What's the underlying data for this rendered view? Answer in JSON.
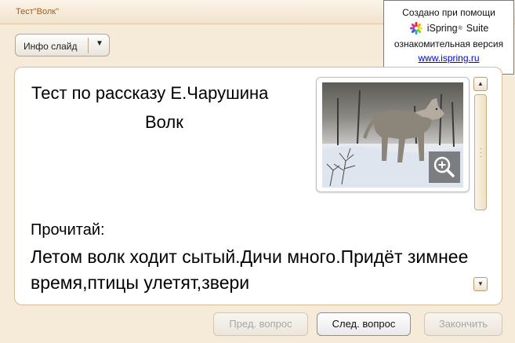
{
  "window": {
    "title": "Тест\"Волк\""
  },
  "watermark": {
    "line1": "Создано при помощи",
    "brand": "iSpring",
    "brand_suffix": "Suite",
    "line3": "ознакомительная версия",
    "link": "www.ispring.ru"
  },
  "toolbar": {
    "info_slide_label": "Инфо слайд"
  },
  "question": {
    "title": "Тест по рассказу Е.Чарушина",
    "subtitle": "Волк",
    "read_label": "Прочитай:",
    "text": "Летом волк ходит сытый.Дичи много.Придёт зимнее время,птицы улетят,звери"
  },
  "navigation": {
    "prev_label": "Пред. вопрос",
    "next_label": "След. вопрос",
    "finish_label": "Закончить"
  },
  "colors": {
    "background": "#f6ead8",
    "title_text": "#a25a1a",
    "card_border": "#d7bd95",
    "link": "#0000cc"
  }
}
